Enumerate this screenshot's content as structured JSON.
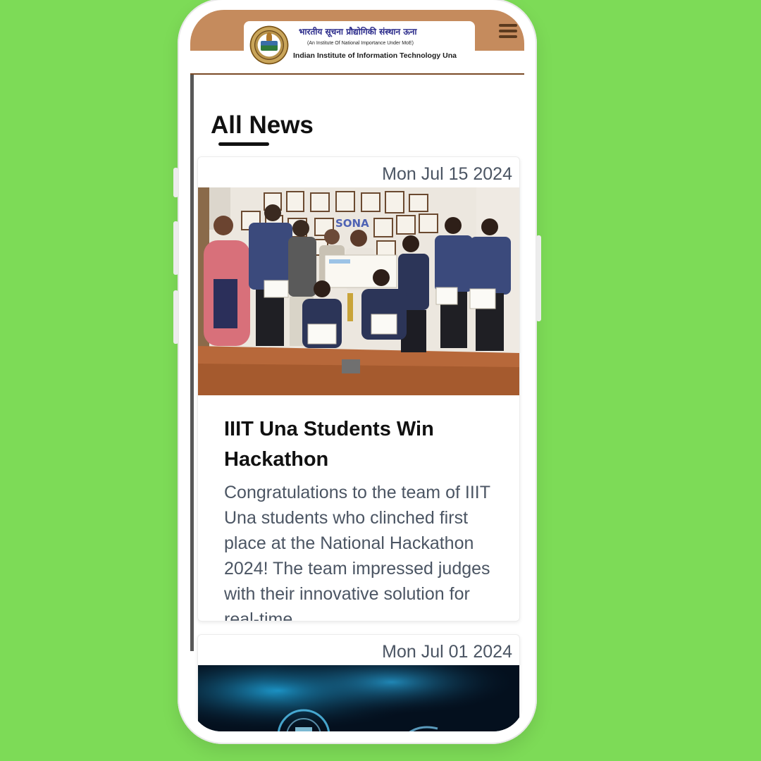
{
  "header": {
    "logo_hindi": "भारतीय सूचना प्रौद्योगिकी संस्थान ऊना",
    "logo_subtitle": "(An Institute Of National Importance Under MoE)",
    "logo_english": "Indian Institute of Information Technology Una",
    "menu_icon": "hamburger-menu-icon"
  },
  "page": {
    "title": "All News"
  },
  "news": [
    {
      "date": "Mon Jul 15 2024",
      "title": "IIIT Una Students Win Hackathon",
      "description": "Congratulations to the team of IIIT Una students who clinched first place at the National Hackathon 2024! The team impressed judges with their innovative solution for real-time"
    },
    {
      "date": "Mon Jul 01 2024"
    }
  ],
  "colors": {
    "background": "#7ddb57",
    "header": "#c58b5d",
    "header_border": "#7a4a26",
    "text": "#111111",
    "muted_text": "#4b5563"
  }
}
